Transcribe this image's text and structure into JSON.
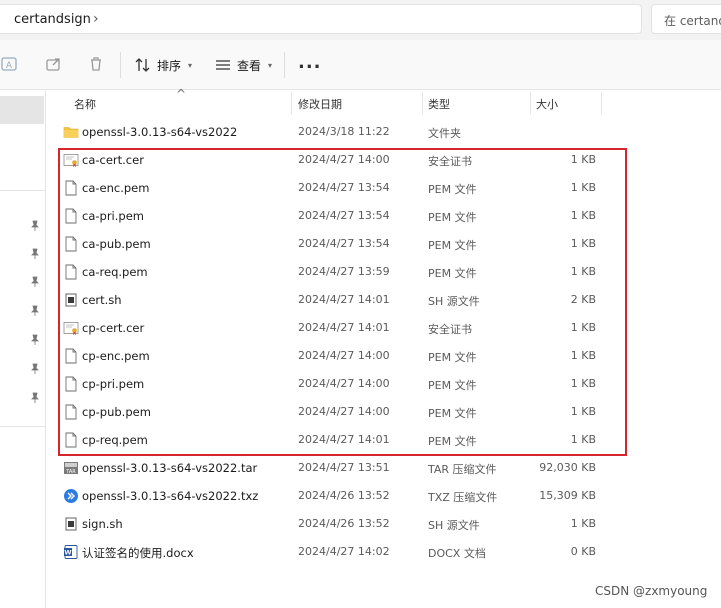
{
  "address": {
    "crumb": "certandsign",
    "search_placeholder": "在 certand"
  },
  "toolbar": {
    "sort_label": "排序",
    "view_label": "查看",
    "more_label": "..."
  },
  "columns": {
    "name": "名称",
    "date": "修改日期",
    "type": "类型",
    "size": "大小"
  },
  "files": [
    {
      "name": "openssl-3.0.13-s64-vs2022",
      "date": "2024/3/18 11:22",
      "type": "文件夹",
      "size": "",
      "icon": "folder-icon"
    },
    {
      "name": "ca-cert.cer",
      "date": "2024/4/27 14:00",
      "type": "安全证书",
      "size": "1 KB",
      "icon": "certificate-icon"
    },
    {
      "name": "ca-enc.pem",
      "date": "2024/4/27 13:54",
      "type": "PEM 文件",
      "size": "1 KB",
      "icon": "file-icon"
    },
    {
      "name": "ca-pri.pem",
      "date": "2024/4/27 13:54",
      "type": "PEM 文件",
      "size": "1 KB",
      "icon": "file-icon"
    },
    {
      "name": "ca-pub.pem",
      "date": "2024/4/27 13:54",
      "type": "PEM 文件",
      "size": "1 KB",
      "icon": "file-icon"
    },
    {
      "name": "ca-req.pem",
      "date": "2024/4/27 13:59",
      "type": "PEM 文件",
      "size": "1 KB",
      "icon": "file-icon"
    },
    {
      "name": "cert.sh",
      "date": "2024/4/27 14:01",
      "type": "SH 源文件",
      "size": "2 KB",
      "icon": "script-icon"
    },
    {
      "name": "cp-cert.cer",
      "date": "2024/4/27 14:01",
      "type": "安全证书",
      "size": "1 KB",
      "icon": "certificate-icon"
    },
    {
      "name": "cp-enc.pem",
      "date": "2024/4/27 14:00",
      "type": "PEM 文件",
      "size": "1 KB",
      "icon": "file-icon"
    },
    {
      "name": "cp-pri.pem",
      "date": "2024/4/27 14:00",
      "type": "PEM 文件",
      "size": "1 KB",
      "icon": "file-icon"
    },
    {
      "name": "cp-pub.pem",
      "date": "2024/4/27 14:00",
      "type": "PEM 文件",
      "size": "1 KB",
      "icon": "file-icon"
    },
    {
      "name": "cp-req.pem",
      "date": "2024/4/27 14:01",
      "type": "PEM 文件",
      "size": "1 KB",
      "icon": "file-icon"
    },
    {
      "name": "openssl-3.0.13-s64-vs2022.tar",
      "date": "2024/4/27 13:51",
      "type": "TAR 压缩文件",
      "size": "92,030 KB",
      "icon": "archive-icon"
    },
    {
      "name": "openssl-3.0.13-s64-vs2022.txz",
      "date": "2024/4/26 13:52",
      "type": "TXZ 压缩文件",
      "size": "15,309 KB",
      "icon": "txz-archive-icon"
    },
    {
      "name": "sign.sh",
      "date": "2024/4/26 13:52",
      "type": "SH 源文件",
      "size": "1 KB",
      "icon": "script-icon"
    },
    {
      "name": "认证签名的使用.docx",
      "date": "2024/4/27 14:02",
      "type": "DOCX 文档",
      "size": "0 KB",
      "icon": "word-doc-icon"
    }
  ],
  "watermark": "CSDN @zxmyoung",
  "colors": {
    "highlight": "#d7262b",
    "folder": "#f4c542",
    "word": "#2b579a"
  }
}
